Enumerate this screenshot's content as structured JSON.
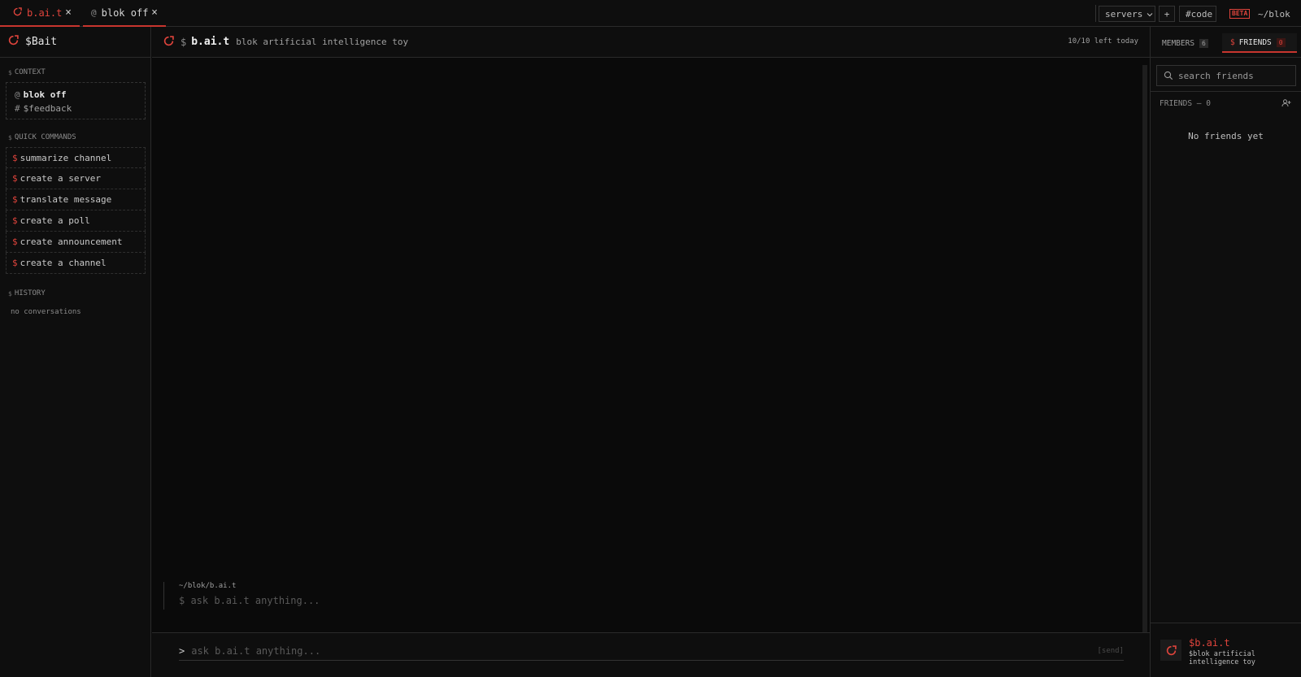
{
  "tabs": [
    {
      "icon": "bait-logo-icon",
      "label": "b.ai.t",
      "close": "×"
    },
    {
      "icon": "at-icon",
      "prefix": "@",
      "label": "blok off",
      "close": "×"
    }
  ],
  "topbar": {
    "servers_label": "servers",
    "plus_label": "+",
    "code_label": "#code",
    "beta_label": "BETA",
    "path_label": "~/blok"
  },
  "sidebar": {
    "title": "$Bait",
    "context_title": "CONTEXT",
    "context": [
      {
        "prefix": "@",
        "label": "blok off"
      },
      {
        "prefix": "#",
        "label": "$feedback"
      }
    ],
    "quick_title": "QUICK COMMANDS",
    "commands": [
      "summarize channel",
      "create a server",
      "translate message",
      "create a poll",
      "create announcement",
      "create a channel"
    ],
    "history_title": "HISTORY",
    "history_empty": "no conversations"
  },
  "main": {
    "title": "b.ai.t",
    "subtitle": "blok artificial intelligence toy",
    "quota": "10/10 left today",
    "prompt_path": "~/blok/b.ai.t",
    "prompt_placeholder": "$ ask b.ai.t anything...",
    "input_caret": ">",
    "input_placeholder": "ask b.ai.t anything...",
    "send_label": "[send]"
  },
  "rightpanel": {
    "members_label": "MEMBERS",
    "members_count": "6",
    "friends_label": "FRIENDS",
    "friends_count": "0",
    "search_placeholder": "search friends",
    "friends_header": "FRIENDS — 0",
    "empty_text": "No friends yet",
    "footer_name": "$b.ai.t",
    "footer_desc": "$blok artificial intelligence toy"
  },
  "colors": {
    "accent": "#e0443c",
    "background": "#0b0b0b",
    "panel": "#0e0e0e",
    "border": "#2a2a2a"
  }
}
